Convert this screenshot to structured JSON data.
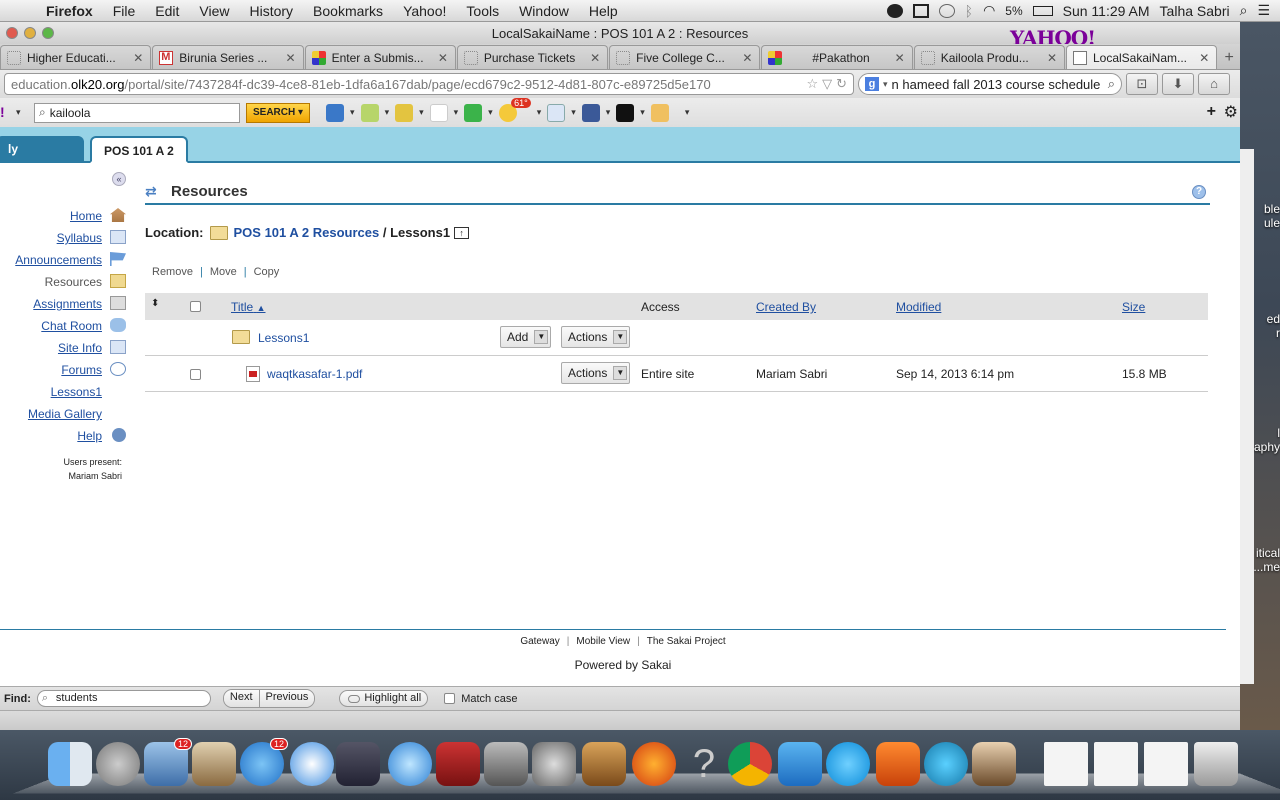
{
  "menubar": {
    "app": "Firefox",
    "items": [
      "File",
      "Edit",
      "View",
      "History",
      "Bookmarks",
      "Yahoo!",
      "Tools",
      "Window",
      "Help"
    ],
    "battery": "5%",
    "clock": "Sun 11:29 AM",
    "user": "Talha Sabri"
  },
  "window": {
    "title": "LocalSakaiName : POS 101 A 2 : Resources",
    "yahoo_logo": "YAHOO!"
  },
  "tabs": [
    {
      "title": "Higher Educati...",
      "icon": "dotted"
    },
    {
      "title": "Birunia Series ...",
      "icon": "gmail"
    },
    {
      "title": "Enter a Submis...",
      "icon": "pin"
    },
    {
      "title": "Purchase Tickets",
      "icon": "dotted"
    },
    {
      "title": "Five College C...",
      "icon": "dotted"
    },
    {
      "title": "#Pakathon",
      "icon": "pin"
    },
    {
      "title": "Kailoola Produ...",
      "icon": "dotted"
    },
    {
      "title": "LocalSakaiNam...",
      "icon": "sakai"
    }
  ],
  "navbar": {
    "url_host": "education.olk20.org",
    "url_prefix": "education.",
    "url_domain": "olk20.org",
    "url_path": "/portal/site/7437284f-dc39-4ce8-81eb-1dfa6a167dab/page/ecd679c2-9512-4d81-807c-e89725d5e170",
    "search_value": "n hameed fall 2013 course schedule"
  },
  "ytoolbar": {
    "search_value": "kailoola",
    "search_button": "SEARCH",
    "weather": "61°"
  },
  "sakai": {
    "tabs": {
      "workspace": "ly Workspace",
      "site": "POS 101 A 2"
    },
    "tools": [
      "Home",
      "Syllabus",
      "Announcements",
      "Resources",
      "Assignments",
      "Chat Room",
      "Site Info",
      "Forums",
      "Lessons1",
      "Media Gallery",
      "Help"
    ],
    "users_present_label": "Users present:",
    "users_present_name": "Mariam Sabri",
    "title": "Resources",
    "location_label": "Location:",
    "location_link": "POS 101 A 2 Resources",
    "location_sep": " / ",
    "location_current": "Lessons1",
    "actions": {
      "remove": "Remove",
      "move": "Move",
      "copy": "Copy"
    },
    "table": {
      "headers": {
        "title": "Title",
        "access": "Access",
        "created_by": "Created By",
        "modified": "Modified",
        "size": "Size"
      },
      "rows": [
        {
          "name": "Lessons1",
          "type": "folder",
          "add": "Add",
          "actions": "Actions"
        },
        {
          "name": "waqtkasafar-1.pdf",
          "type": "pdf",
          "actions": "Actions",
          "access": "Entire site",
          "created_by": "Mariam Sabri",
          "modified": "Sep 14, 2013 6:14 pm",
          "size": "15.8 MB"
        }
      ]
    },
    "footer": {
      "links": [
        "Gateway",
        "Mobile View",
        "The Sakai Project"
      ],
      "powered": "Powered by Sakai"
    }
  },
  "findbar": {
    "label": "Find:",
    "value": "students",
    "next": "Next",
    "previous": "Previous",
    "highlight": "Highlight all",
    "match_case": "Match case",
    "zotero": "zotero"
  },
  "desktop": {
    "labels": [
      "ble",
      "ule",
      "ed",
      "r",
      "l",
      "aphy",
      "itical",
      "...me"
    ]
  },
  "dock": {
    "mail_badge": "12",
    "appstore_badge": "12"
  }
}
